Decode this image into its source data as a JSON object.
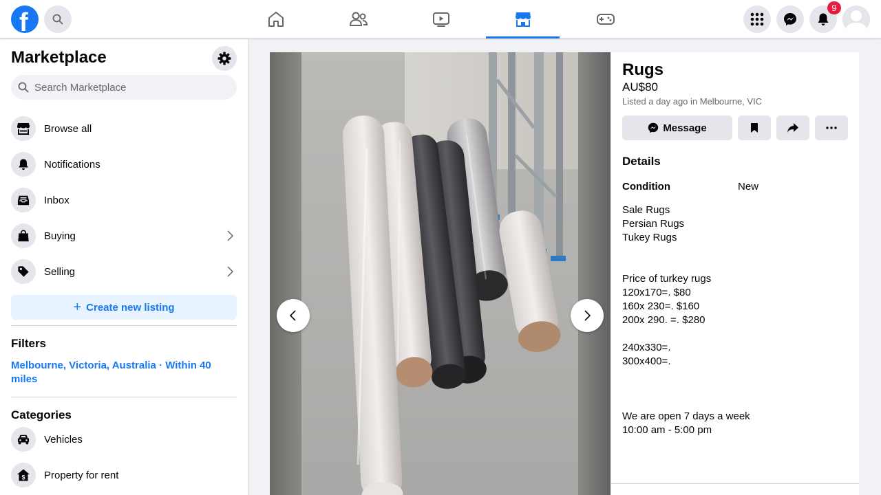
{
  "topbar": {
    "logo_letter": "f",
    "notification_count": "9",
    "active_tab": "marketplace"
  },
  "sidebar": {
    "title": "Marketplace",
    "search_placeholder": "Search Marketplace",
    "nav": [
      {
        "label": "Browse all",
        "icon": "storefront-icon"
      },
      {
        "label": "Notifications",
        "icon": "bell-icon"
      },
      {
        "label": "Inbox",
        "icon": "inbox-icon"
      },
      {
        "label": "Buying",
        "icon": "shopping-bag-icon"
      },
      {
        "label": "Selling",
        "icon": "tag-icon"
      }
    ],
    "create_label": "Create new listing",
    "filters_heading": "Filters",
    "location_filter": "Melbourne, Victoria, Australia · Within 40 miles",
    "categories_heading": "Categories",
    "categories": [
      {
        "label": "Vehicles",
        "icon": "car-icon"
      },
      {
        "label": "Property for rent",
        "icon": "house-dollar-icon"
      }
    ]
  },
  "listing": {
    "title": "Rugs",
    "price": "AU$80",
    "listed": "Listed a day ago in Melbourne, VIC",
    "message_label": "Message",
    "details_heading": "Details",
    "condition_label": "Condition",
    "condition_value": "New",
    "description": [
      "Sale Rugs",
      "Persian Rugs",
      "Tukey Rugs",
      "",
      "",
      "Price of turkey rugs",
      "120x170=.  $80",
      "160x 230=.  $160",
      "200x 290. =.  $280",
      "",
      "240x330=.",
      "300x400=.",
      "",
      "",
      "",
      "We are open 7 days a week",
      "10:00 am - 5:00 pm"
    ]
  },
  "colors": {
    "brand": "#1877f2",
    "badge": "#e41e3f",
    "link": "#1877f2"
  }
}
